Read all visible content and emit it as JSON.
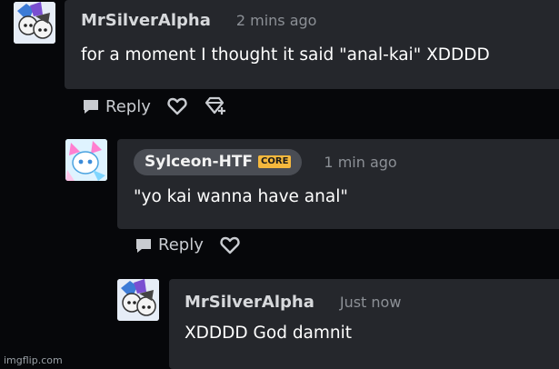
{
  "comments": [
    {
      "username": "MrSilverAlpha",
      "time": "2 mins ago",
      "text": "for a moment I thought it said \"anal-kai\" XDDDD",
      "reply_label": "Reply"
    },
    {
      "username": "Sylceon-HTF",
      "badge": "CORE",
      "time": "1 min ago",
      "text": "\"yo kai wanna have anal\"",
      "reply_label": "Reply"
    },
    {
      "username": "MrSilverAlpha",
      "time": "Just now",
      "text": "XDDDD God damnit"
    }
  ],
  "watermark": "imgflip.com",
  "colors": {
    "background": "#06070a",
    "bubble": "#25272c",
    "badge": "#f5b83d",
    "pill": "#4a4d54"
  }
}
